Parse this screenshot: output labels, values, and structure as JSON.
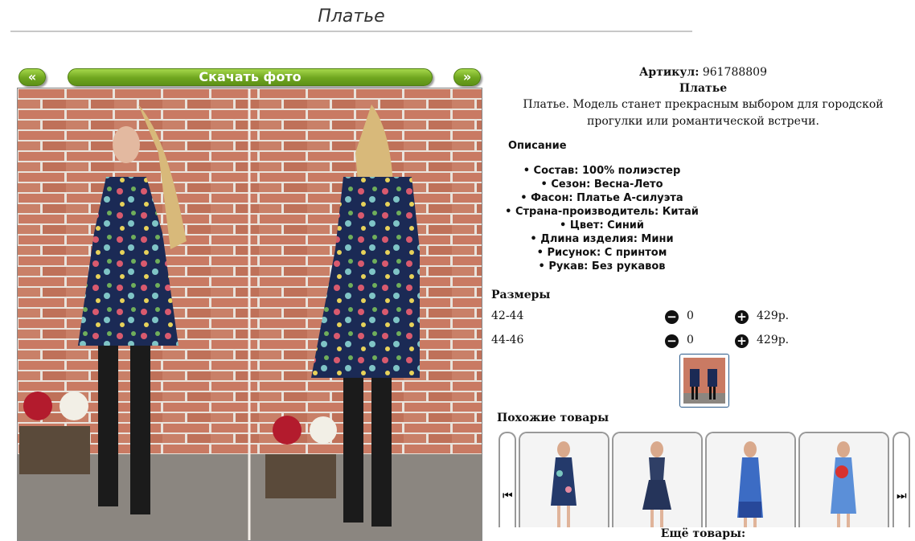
{
  "page": {
    "title": "Платье"
  },
  "gallery": {
    "prev_label": "«",
    "next_label": "»",
    "download_label": "Скачать фото"
  },
  "product": {
    "article_label": "Артикул:",
    "article_value": "961788809",
    "name": "Платье",
    "description": "Платье. Модель станет прекрасным выбором для городской прогулки или романтической встречи."
  },
  "features": {
    "title": "Описание",
    "items": [
      "Состав: 100% полиэстер",
      "Сезон: Весна-Лето",
      "Фасон: Платье А-силуэта",
      "Страна-производитель: Китай",
      "Цвет: Синий",
      "Длина изделия: Мини",
      "Рисунок: С принтом",
      "Рукав: Без рукавов"
    ]
  },
  "sizes": {
    "title": "Размеры",
    "rows": [
      {
        "size": "42-44",
        "qty": "0",
        "price": "429р."
      },
      {
        "size": "44-46",
        "qty": "0",
        "price": "429р."
      }
    ]
  },
  "similar": {
    "title": "Похожие товары",
    "prev_icon": "skip-previous-icon",
    "next_icon": "skip-next-icon",
    "prev_glyph": "⏮",
    "next_glyph": "⏭"
  },
  "more": {
    "title": "Ещё товары:"
  },
  "colors": {
    "button_green": "#6fa51f",
    "brick": "#c97a63",
    "dress_navy": "#1b2a55"
  }
}
